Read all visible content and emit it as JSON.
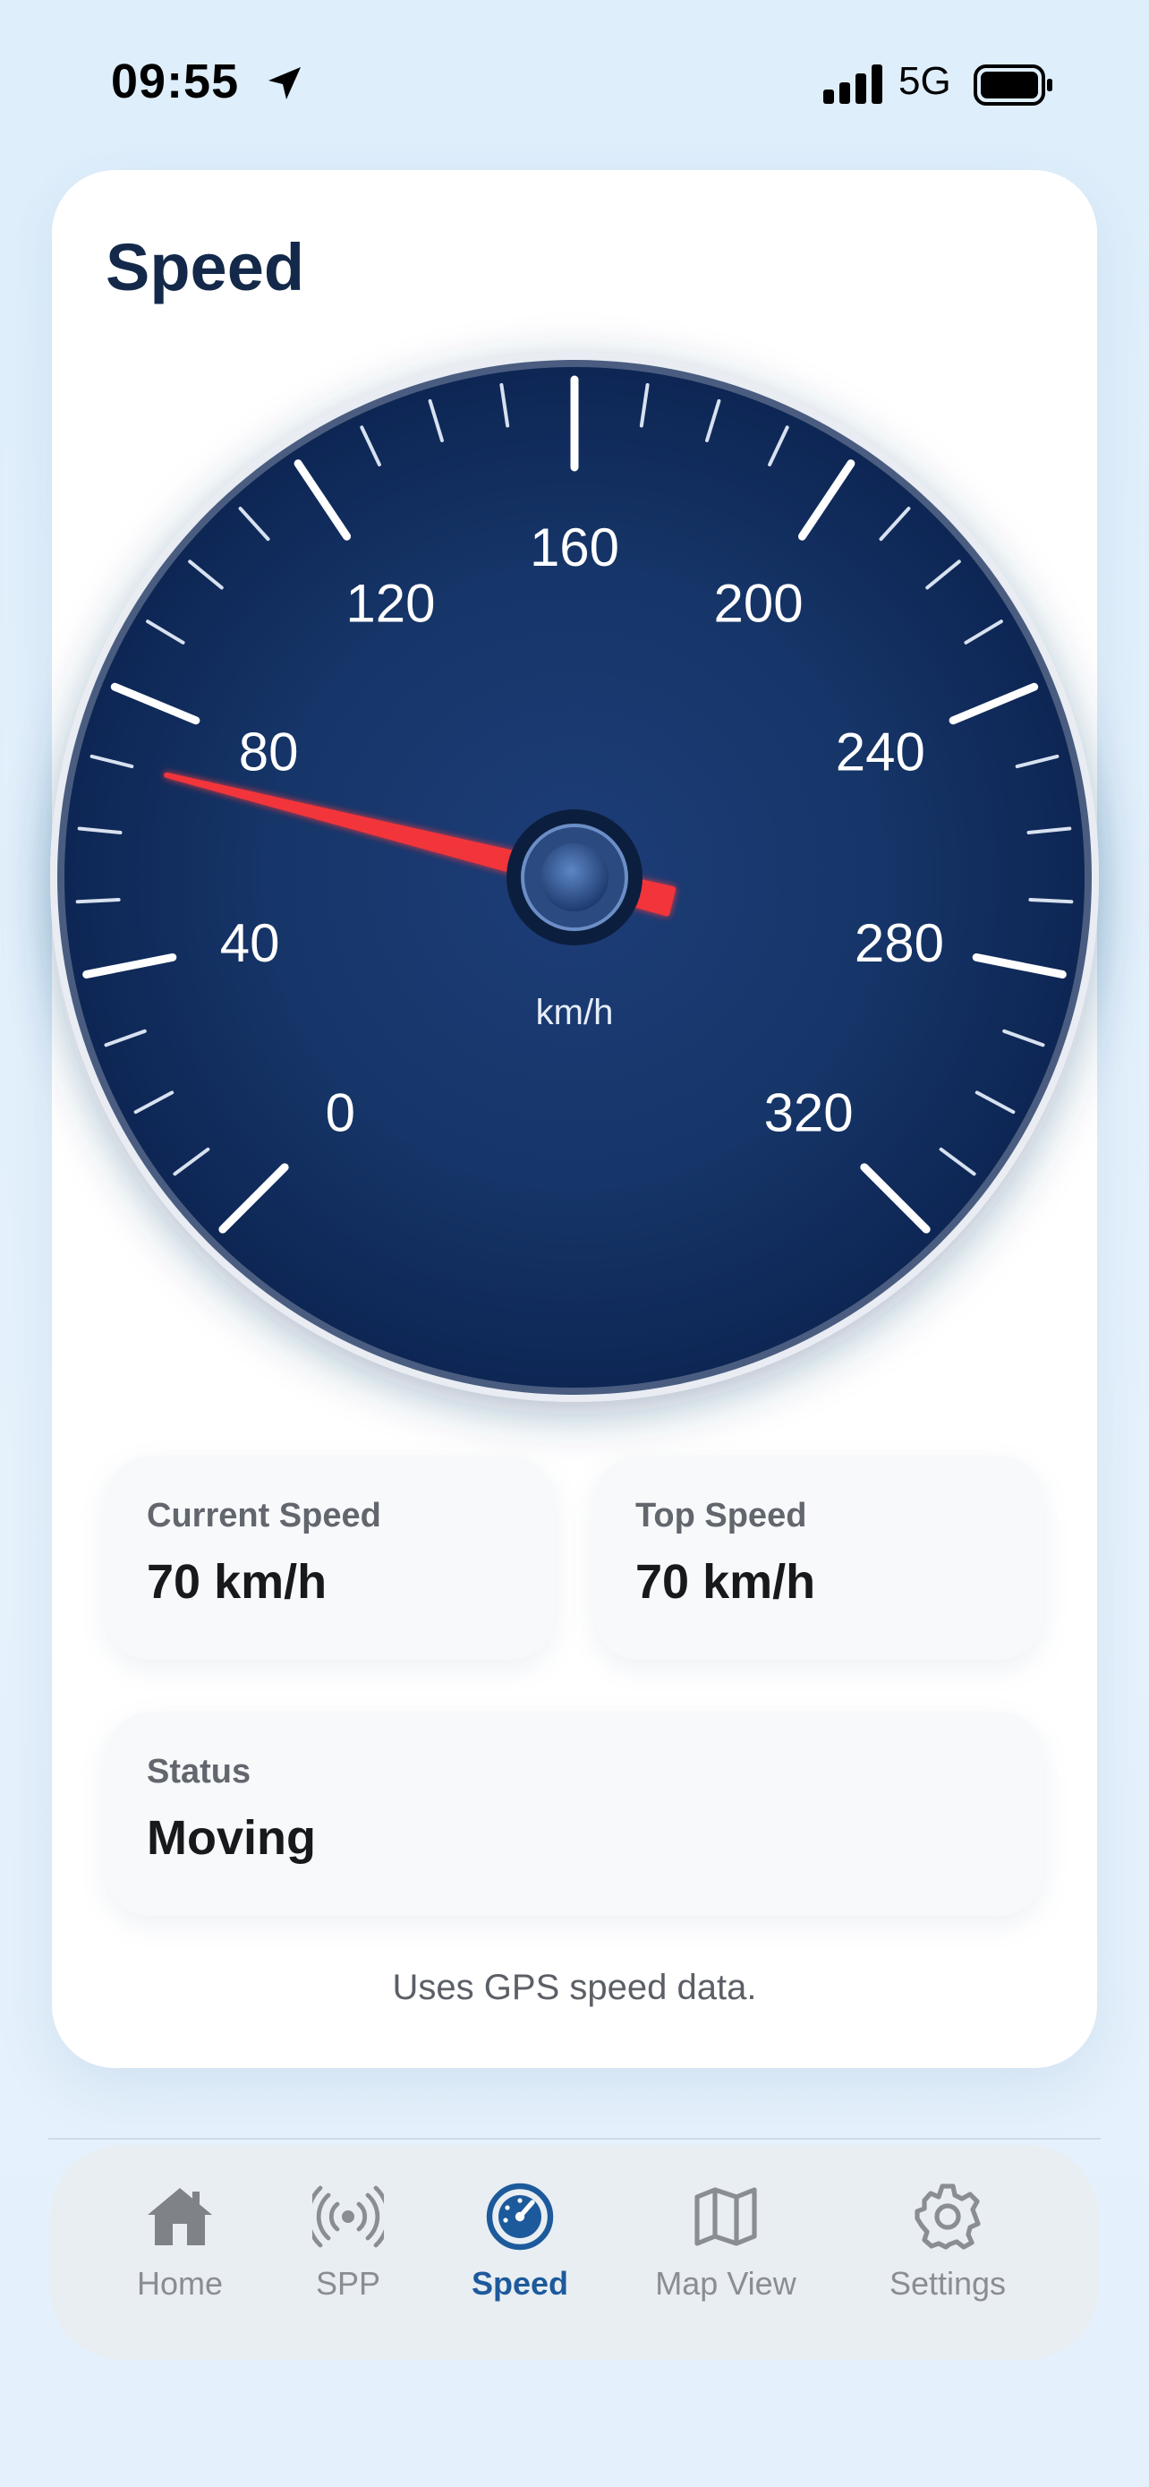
{
  "status_bar": {
    "time": "09:55",
    "network": "5G",
    "icons": [
      "location-arrow-icon",
      "cellular-signal-icon",
      "battery-icon"
    ]
  },
  "page": {
    "title": "Speed"
  },
  "gauge": {
    "unit": "km/h",
    "min": 0,
    "max": 320,
    "tick_labels": [
      "0",
      "40",
      "80",
      "120",
      "160",
      "200",
      "240",
      "280",
      "320"
    ],
    "needle_value": 70,
    "needle_color": "#f2353b",
    "dial_color": "#0f2a5c"
  },
  "stats": {
    "current_speed": {
      "label": "Current Speed",
      "value": "70 km/h"
    },
    "top_speed": {
      "label": "Top Speed",
      "value": "70 km/h"
    },
    "status": {
      "label": "Status",
      "value": "Moving"
    }
  },
  "footnote": "Uses GPS speed data.",
  "tabbar": {
    "active": "Speed",
    "accent_color": "#1d5a9c",
    "tabs": [
      {
        "label": "Home",
        "icon": "house-icon"
      },
      {
        "label": "SPP",
        "icon": "broadcast-icon"
      },
      {
        "label": "Speed",
        "icon": "speedometer-icon"
      },
      {
        "label": "Map View",
        "icon": "map-icon"
      },
      {
        "label": "Settings",
        "icon": "gear-icon"
      }
    ]
  }
}
